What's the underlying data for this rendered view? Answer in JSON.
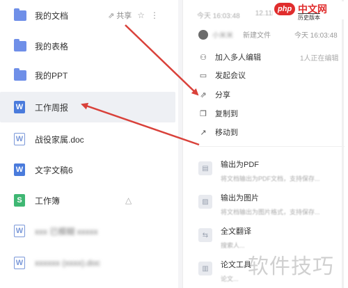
{
  "files": [
    {
      "name": "我的文档",
      "type": "folder",
      "share_label": "共享"
    },
    {
      "name": "我的表格",
      "type": "folder"
    },
    {
      "name": "我的PPT",
      "type": "folder"
    },
    {
      "name": "工作周报",
      "type": "word-solid",
      "selected": true
    },
    {
      "name": "战役家属.doc",
      "type": "word-outline"
    },
    {
      "name": "文字文稿6",
      "type": "word-solid"
    },
    {
      "name": "工作簿",
      "type": "sheet"
    },
    {
      "name": "xxx 已模糊 xxxxx",
      "type": "word-outline",
      "blurred": true
    },
    {
      "name": "xxxxxx (xxxx).doc",
      "type": "word-outline",
      "blurred": true
    }
  ],
  "icon_glyphs": {
    "word": "W",
    "sheet": "S"
  },
  "details": {
    "modified_time": "今天 16:03:48",
    "file_size": "12.11KB",
    "creator_blurred": "小米米",
    "action_text": "新建文件",
    "creator_time": "今天 16:03:48"
  },
  "menu": [
    {
      "label": "加入多人编辑",
      "icon": "add-user-icon",
      "note": "1人正在编辑"
    },
    {
      "label": "发起会议",
      "icon": "video-icon"
    },
    {
      "label": "分享",
      "icon": "share-icon"
    },
    {
      "label": "复制到",
      "icon": "copy-icon"
    },
    {
      "label": "移动到",
      "icon": "move-icon"
    }
  ],
  "exports": [
    {
      "title": "输出为PDF",
      "desc": "将文档输出为PDF文档，支持保存..."
    },
    {
      "title": "输出为图片",
      "desc": "将文档输出为图片格式，支持保存..."
    },
    {
      "title": "全文翻译",
      "desc": "搜索人..."
    },
    {
      "title": "论文工具",
      "desc": "论文..."
    }
  ],
  "logo": {
    "badge": "php",
    "name": "中文网",
    "sub": "历史版本"
  },
  "watermark": "软件技巧",
  "colors": {
    "arrow": "#d9413a",
    "accent": "#4a7bdc",
    "selected_bg": "#eef0f4"
  }
}
